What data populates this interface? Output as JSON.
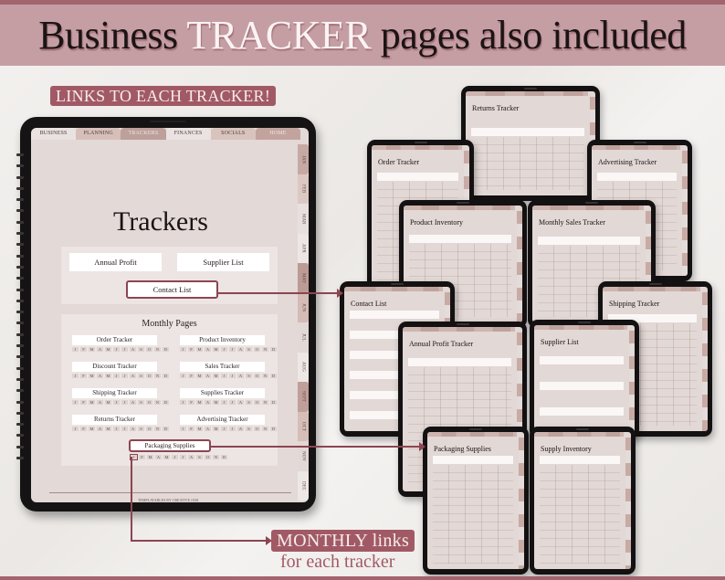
{
  "banner": {
    "title_pre": "Business ",
    "title_highlight": "TRACKER",
    "title_post": " pages also included"
  },
  "callouts": {
    "links_badge": "LINKS TO EACH TRACKER!",
    "monthly_badge": "MONTHLY links",
    "monthly_sub": "for each tracker"
  },
  "colors": {
    "accent": "#a15a65",
    "banner_bg": "#c59ea4",
    "screen_bg": "#e3d9d6"
  },
  "main_tablet": {
    "top_tabs": [
      "BUSINESS",
      "PLANNING",
      "TRACKERS",
      "FINANCES",
      "SOCIALS",
      "HOME"
    ],
    "side_tabs": [
      "JAN",
      "FEB",
      "MAR",
      "APR",
      "MAY",
      "JUN",
      "JUL",
      "AUG",
      "SEPT",
      "OCT",
      "NOV",
      "DEC"
    ],
    "page_title": "Trackers",
    "links": {
      "annual_profit": "Annual Profit",
      "supplier_list": "Supplier List",
      "contact_list": "Contact List"
    },
    "monthly_heading": "Monthly Pages",
    "monthly_trackers": [
      "Order Tracker",
      "Product Inventory",
      "Discount Tracker",
      "Sales Tracker",
      "Shipping Tracker",
      "Supplies Tracker",
      "Returns Tracker",
      "Advertising Tracker"
    ],
    "packaging": "Packaging Supplies",
    "month_letters": [
      "J",
      "F",
      "M",
      "A",
      "M",
      "J",
      "J",
      "A",
      "S",
      "O",
      "N",
      "D"
    ],
    "footer": "TEMPLATABLES BY CREATIVE JAM"
  },
  "previews": [
    {
      "title": "Returns Tracker"
    },
    {
      "title": "Order Tracker"
    },
    {
      "title": "Advertising Tracker"
    },
    {
      "title": "Product Inventory"
    },
    {
      "title": "Monthly Sales Tracker"
    },
    {
      "title": "Contact List"
    },
    {
      "title": "Shipping Tracker"
    },
    {
      "title": "Annual Profit Tracker"
    },
    {
      "title": "Supplier List"
    },
    {
      "title": "Packaging Supplies"
    },
    {
      "title": "Supply Inventory"
    }
  ]
}
